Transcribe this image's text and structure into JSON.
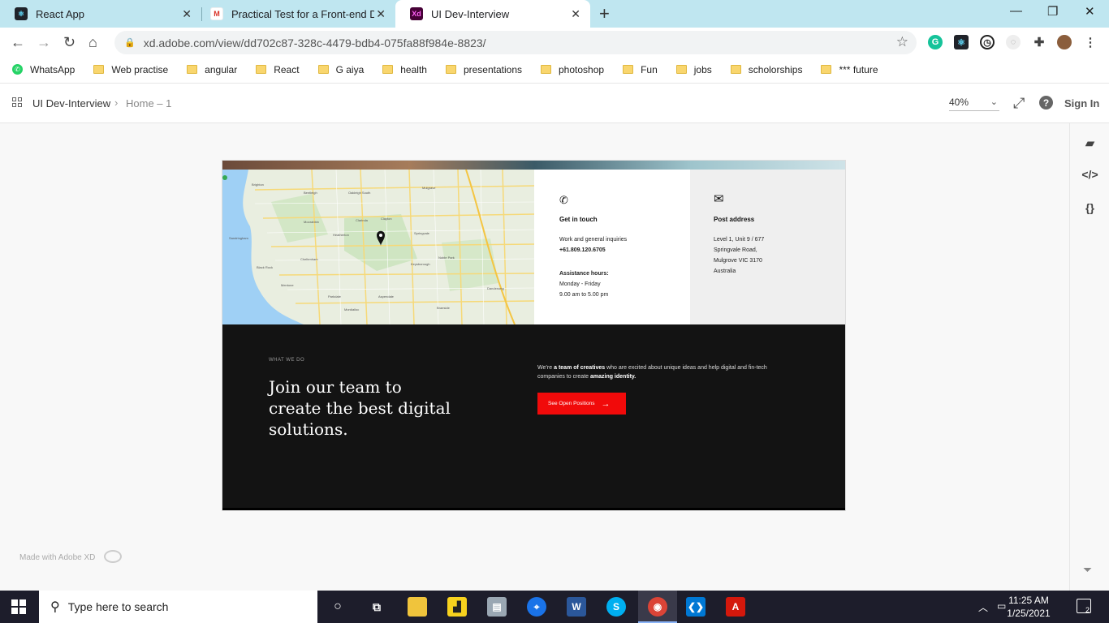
{
  "browser": {
    "tabs": [
      {
        "title": "React App",
        "icon": "react-icon",
        "active": false
      },
      {
        "title": "Practical Test for a Front-end Dev",
        "icon": "gmail-icon",
        "active": false
      },
      {
        "title": "UI Dev-Interview",
        "icon": "adobe-xd-icon",
        "active": true
      }
    ],
    "url": "xd.adobe.com/view/dd702c87-328c-4479-bdb4-075fa88f984e-8823/",
    "bookmarks": [
      "WhatsApp",
      "Web practise",
      "angular",
      "React",
      "G aiya",
      "health",
      "presentations",
      "photoshop",
      "Fun",
      "jobs",
      "scholorships",
      "*** future"
    ]
  },
  "xd": {
    "project": "UI Dev-Interview",
    "page": "Home – 1",
    "zoom": "40%",
    "sign_in": "Sign In",
    "made_with": "Made with Adobe XD"
  },
  "artboard": {
    "contact": {
      "heading": "Get in touch",
      "work_label": "Work and general inquiries",
      "phone": "+61.809.120.6705",
      "hours_label": "Assistance hours:",
      "days": "Monday - Friday",
      "hours": "9.00 am to 5.00 pm"
    },
    "post": {
      "heading": "Post address",
      "line1": "Level 1, Unit 9 / 677",
      "line2": "Springvale Road,",
      "line3": "Mulgrove VIC 3170",
      "line4": "Australia"
    },
    "careers": {
      "eyebrow": "WHAT WE DO",
      "headline": "Join our team to create the best digital solutions.",
      "para_1": "We’re ",
      "para_bold_1": "a team of creatives",
      "para_2": " who are excited about unique ideas and help digital and fin-tech companies to create ",
      "para_bold_2": "amazing identity.",
      "cta": "See Open Positions"
    },
    "map_labels": [
      "Clayton",
      "Mulgrave",
      "Springvale",
      "Dandenong",
      "Noble Park",
      "Brighton",
      "Sandringham",
      "Black Rock",
      "Mentone",
      "Moorabbin",
      "Bentleigh",
      "Oakleigh South",
      "Cheltenham",
      "Keysborough",
      "Parkdale",
      "Mordialloc",
      "Aspendale",
      "Braeside",
      "Clarinda",
      "Heatherton"
    ]
  },
  "taskbar": {
    "search_placeholder": "Type here to search",
    "time": "11:25 AM",
    "date": "1/25/2021",
    "notifications": "2"
  },
  "colors": {
    "accent": "#f10a0a",
    "dark": "#131313",
    "tabstrip": "#bfe6f0"
  }
}
